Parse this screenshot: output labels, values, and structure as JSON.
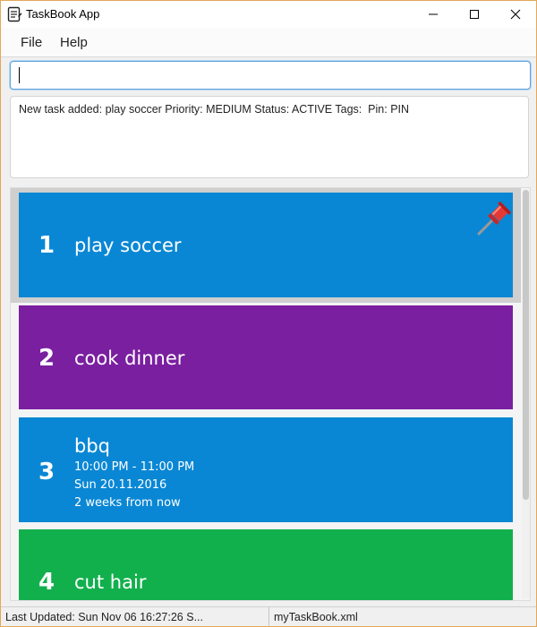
{
  "window": {
    "title": "TaskBook App"
  },
  "menu": {
    "file": "File",
    "help": "Help"
  },
  "command": {
    "value": "",
    "placeholder": ""
  },
  "result": {
    "text": "New task added: play soccer Priority: MEDIUM Status: ACTIVE Tags:  Pin: PIN"
  },
  "tasks": [
    {
      "index": "1",
      "name": "play soccer",
      "color": "#0a87d4",
      "pinned": true
    },
    {
      "index": "2",
      "name": "cook dinner",
      "color": "#7a1fa0",
      "pinned": false
    },
    {
      "index": "3",
      "name": "bbq",
      "color": "#0a87d4",
      "pinned": false,
      "time": "10:00 PM - 11:00 PM",
      "date": "Sun 20.11.2016",
      "relative": "2 weeks from now"
    },
    {
      "index": "4",
      "name": "cut hair",
      "color": "#12b04d",
      "pinned": false
    }
  ],
  "status": {
    "last_updated": "Last Updated: Sun Nov 06 16:27:26 S...",
    "file": "myTaskBook.xml"
  },
  "icons": {
    "app": "notebook-icon",
    "pin": "pushpin-icon",
    "minimize": "minimize-icon",
    "maximize": "maximize-icon",
    "close": "close-icon"
  }
}
